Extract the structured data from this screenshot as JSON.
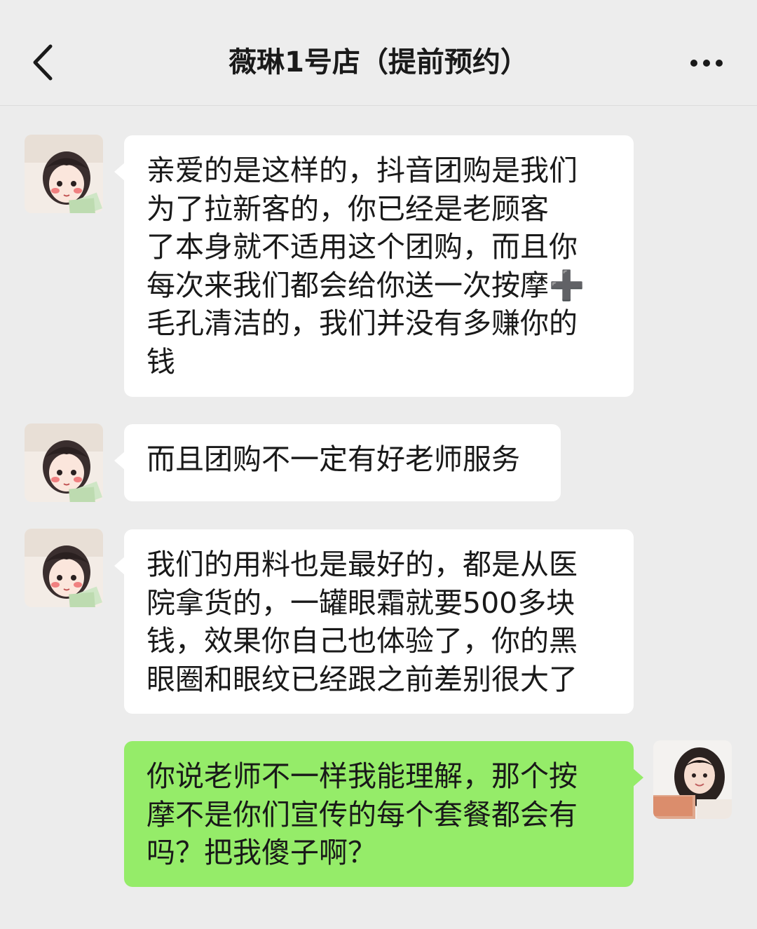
{
  "header": {
    "title": "薇琳1号店（提前预约）",
    "back_icon": "chevron-left-icon",
    "more_icon": "more-dots-icon"
  },
  "messages": [
    {
      "side": "in",
      "lines": [
        "亲爱的是这样的，抖音团购是我们",
        "为了拉新客的，你已经是老顾客",
        "了本身就不适用这个团购，而且你",
        "每次来我们都会给你送一次按摩➕",
        "毛孔清洁的，我们并没有多赚你的",
        "钱"
      ]
    },
    {
      "side": "in",
      "lines": [
        "而且团购不一定有好老师服务"
      ]
    },
    {
      "side": "in",
      "lines": [
        "我们的用料也是最好的，都是从医",
        "院拿货的，一罐眼霜就要500多块",
        "钱，效果你自己也体验了，你的黑",
        "眼圈和眼纹已经跟之前差别很大了"
      ]
    },
    {
      "side": "out",
      "lines": [
        "你说老师不一样我能理解，那个按",
        "摩不是你们宣传的每个套餐都会有",
        "吗？把我傻子啊？"
      ]
    }
  ]
}
